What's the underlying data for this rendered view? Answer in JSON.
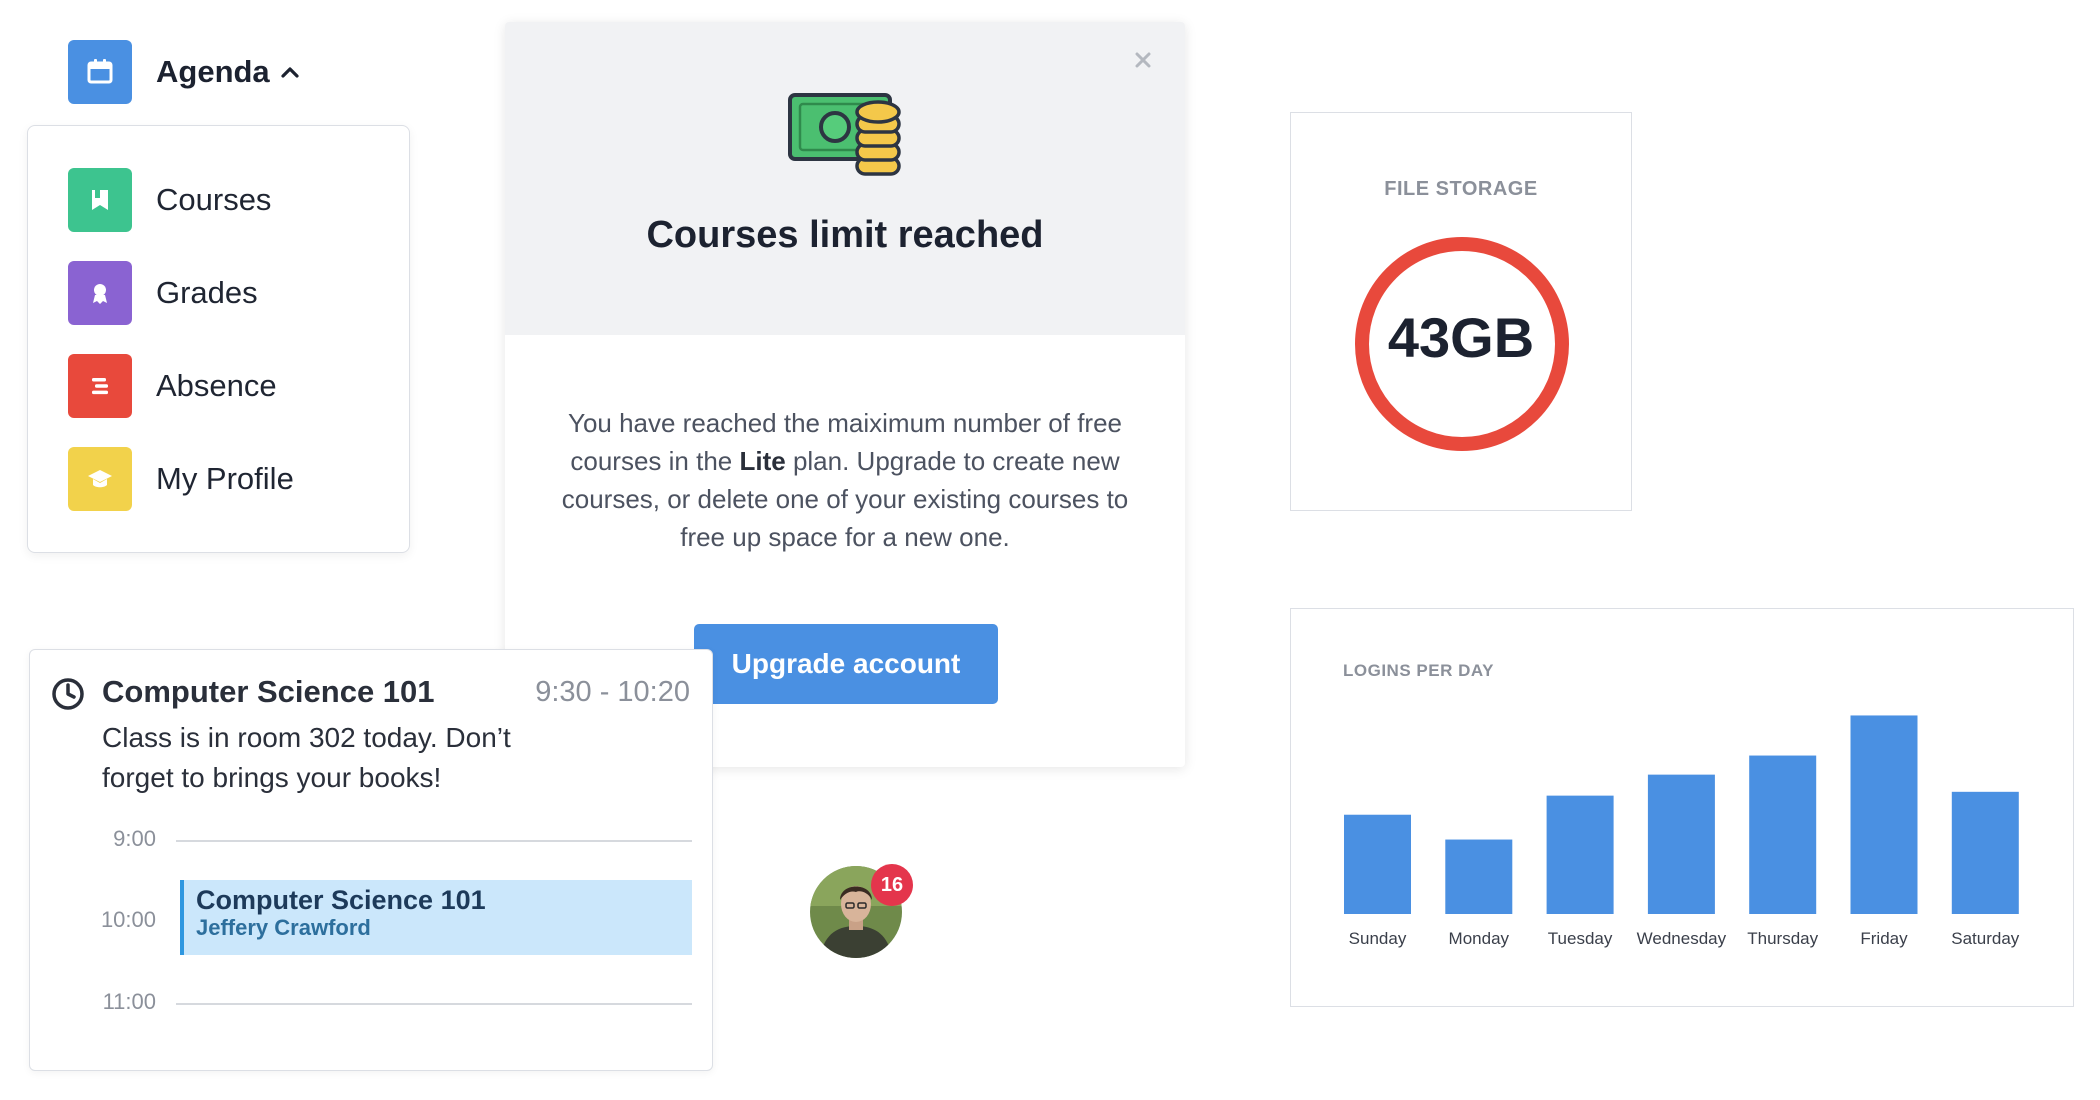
{
  "agenda": {
    "label": "Agenda",
    "icon": "calendar-icon",
    "color": "#4a90e2"
  },
  "menu": {
    "items": [
      {
        "label": "Courses",
        "icon": "book-icon",
        "color": "#3dc48f"
      },
      {
        "label": "Grades",
        "icon": "award-icon",
        "color": "#8a63d2"
      },
      {
        "label": "Absence",
        "icon": "list-icon",
        "color": "#e8493c"
      },
      {
        "label": "My Profile",
        "icon": "graduation-cap-icon",
        "color": "#f2d24b"
      }
    ]
  },
  "modal": {
    "title": "Courses limit reached",
    "body_part1": "You have reached the maiximum number of free courses in the ",
    "body_bold": "Lite",
    "body_part2": " plan. Upgrade to create new courses, or delete one of your existing courses to free up space for a new one.",
    "button_label": "Upgrade account",
    "close_icon": "close-icon",
    "illustration_icon": "money-coins-icon",
    "accent": "#4a90e2"
  },
  "storage": {
    "label": "FILE STORAGE",
    "value": "43GB",
    "ring_color": "#e8493c"
  },
  "schedule": {
    "title": "Computer Science 101",
    "time_range": "9:30 - 10:20",
    "description": "Class is in room 302 today. Don’t forget to brings your books!",
    "timeline": [
      "9:00",
      "10:00",
      "11:00"
    ],
    "event": {
      "title": "Computer Science 101",
      "person": "Jeffery Crawford"
    }
  },
  "avatar": {
    "badge_count": "16",
    "badge_color": "#e4354c"
  },
  "chart_data": {
    "type": "bar",
    "title": "LOGINS PER DAY",
    "categories": [
      "Sunday",
      "Monday",
      "Tuesday",
      "Wednesday",
      "Thursday",
      "Friday",
      "Saturday"
    ],
    "values": [
      52,
      39,
      62,
      73,
      83,
      104,
      64
    ],
    "ylim": [
      0,
      110
    ],
    "grid": false,
    "bar_color": "#4a90e2"
  }
}
